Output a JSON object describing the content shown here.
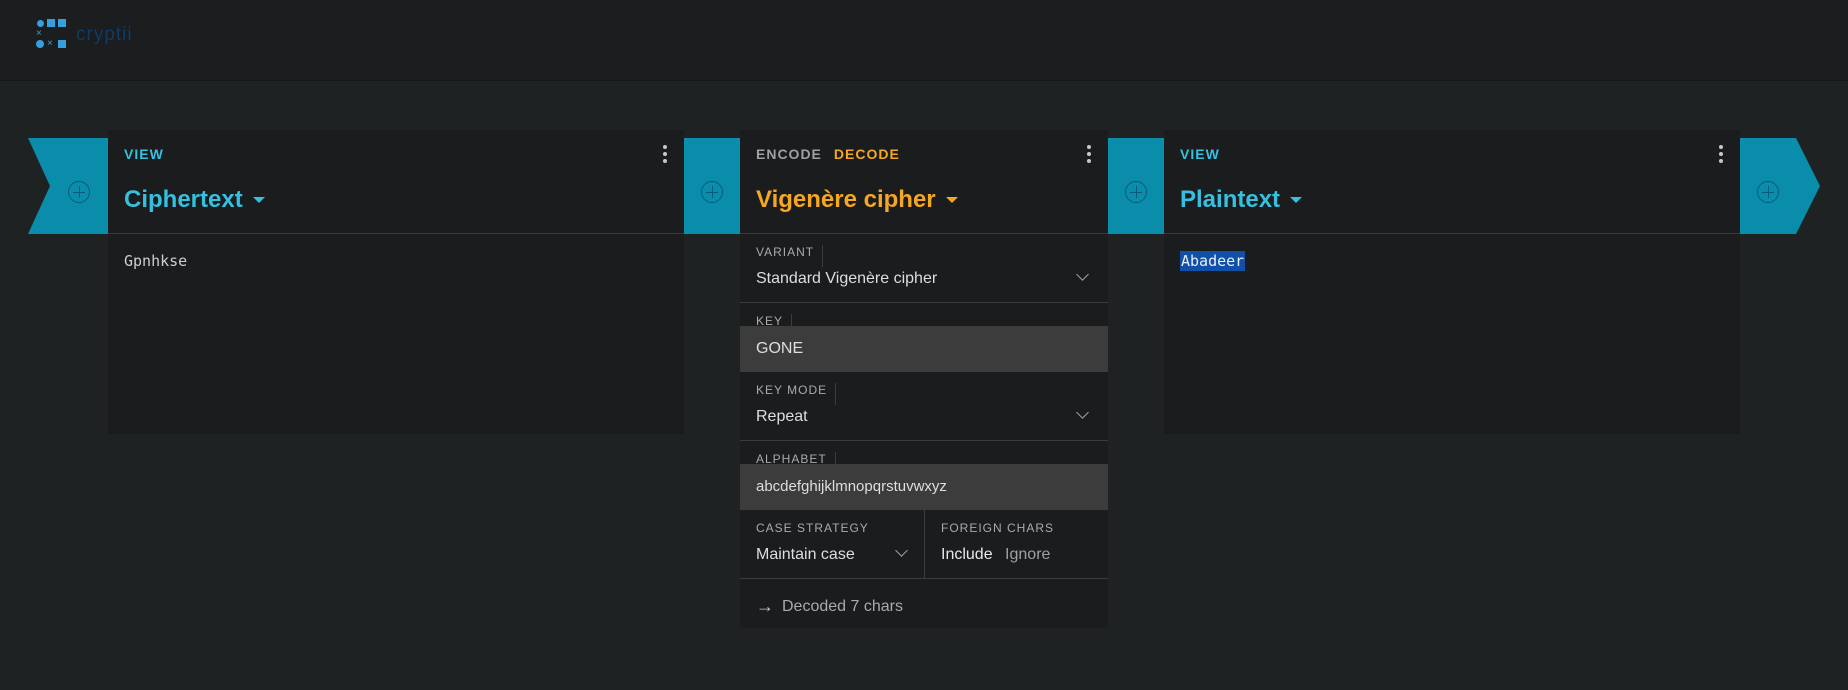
{
  "app": {
    "logo_text": "cryptii"
  },
  "bricks": {
    "left_view": {
      "tab_label": "VIEW",
      "title": "Ciphertext",
      "content": "Gpnhkse"
    },
    "encoder": {
      "tab_encode": "ENCODE",
      "tab_decode": "DECODE",
      "title": "Vigenère cipher",
      "settings": {
        "variant": {
          "label": "VARIANT",
          "value": "Standard Vigenère cipher"
        },
        "key": {
          "label": "KEY",
          "value": "GONE"
        },
        "key_mode": {
          "label": "KEY MODE",
          "value": "Repeat"
        },
        "alphabet": {
          "label": "ALPHABET",
          "value": "abcdefghijklmnopqrstuvwxyz"
        },
        "case_strategy": {
          "label": "CASE STRATEGY",
          "value": "Maintain case"
        },
        "foreign_chars": {
          "label": "FOREIGN CHARS",
          "options": [
            "Include",
            "Ignore"
          ],
          "selected": "Include"
        }
      },
      "status": "Decoded 7 chars"
    },
    "right_view": {
      "tab_label": "VIEW",
      "title": "Plaintext",
      "content": "Abadeer"
    }
  },
  "colors": {
    "accent_view": "#35c0df",
    "accent_encoder": "#f5a623",
    "pipe": "#0a8dab",
    "selection": "#1050a8"
  },
  "icons": [
    "logo-icon",
    "menu-dots-icon",
    "caret-down-icon",
    "chevron-down-icon",
    "add-brick-icon",
    "arrow-right-icon"
  ]
}
